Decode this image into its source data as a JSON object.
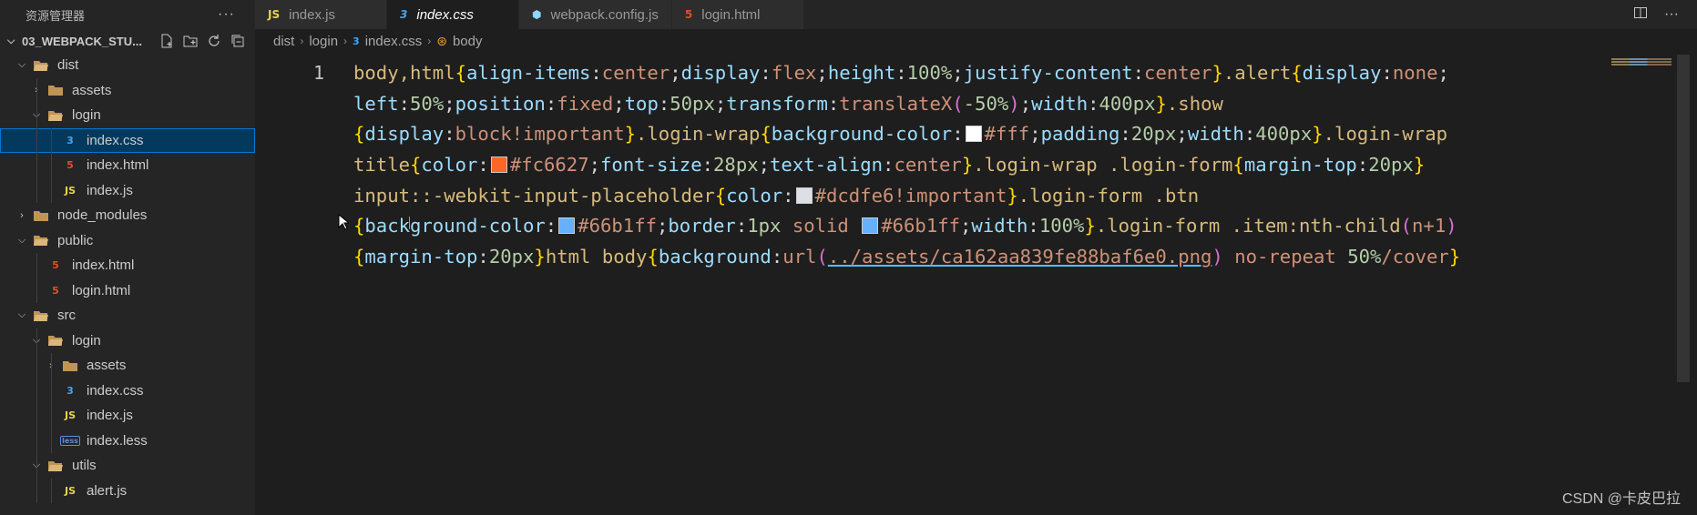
{
  "sidebar": {
    "title": "资源管理器",
    "more": "···",
    "project": "03_WEBPACK_STU...",
    "tree": [
      {
        "label": "dist",
        "icon": "folder-open-icon",
        "depth": 1,
        "chev": "v"
      },
      {
        "label": "assets",
        "icon": "folder-icon",
        "depth": 2,
        "chev": ">"
      },
      {
        "label": "login",
        "icon": "folder-open-icon",
        "depth": 2,
        "chev": "v"
      },
      {
        "label": "index.css",
        "icon": "css-icon",
        "depth": 3,
        "chev": "",
        "selected": true
      },
      {
        "label": "index.html",
        "icon": "html-icon",
        "depth": 3,
        "chev": ""
      },
      {
        "label": "index.js",
        "icon": "js-icon",
        "depth": 3,
        "chev": ""
      },
      {
        "label": "node_modules",
        "icon": "folder-icon",
        "depth": 1,
        "chev": ">"
      },
      {
        "label": "public",
        "icon": "folder-open-icon",
        "depth": 1,
        "chev": "v"
      },
      {
        "label": "index.html",
        "icon": "html-icon",
        "depth": 2,
        "chev": ""
      },
      {
        "label": "login.html",
        "icon": "html-icon",
        "depth": 2,
        "chev": ""
      },
      {
        "label": "src",
        "icon": "folder-open-icon",
        "depth": 1,
        "chev": "v"
      },
      {
        "label": "login",
        "icon": "folder-open-icon",
        "depth": 2,
        "chev": "v"
      },
      {
        "label": "assets",
        "icon": "folder-icon",
        "depth": 3,
        "chev": ">"
      },
      {
        "label": "index.css",
        "icon": "css-icon",
        "depth": 3,
        "chev": ""
      },
      {
        "label": "index.js",
        "icon": "js-icon",
        "depth": 3,
        "chev": ""
      },
      {
        "label": "index.less",
        "icon": "less-icon",
        "depth": 3,
        "chev": ""
      },
      {
        "label": "utils",
        "icon": "folder-open-icon",
        "depth": 2,
        "chev": "v"
      },
      {
        "label": "alert.js",
        "icon": "js-icon",
        "depth": 3,
        "chev": ""
      }
    ]
  },
  "tabs": [
    {
      "label": "index.js",
      "icon_text": "JS",
      "icon_color": "#e8d44d",
      "active": false
    },
    {
      "label": "index.css",
      "icon_text": "3",
      "icon_color": "#42a5f5",
      "active": true
    },
    {
      "label": "webpack.config.js",
      "icon_text": "⬢",
      "icon_color": "#8ed6fb",
      "active": false
    },
    {
      "label": "login.html",
      "icon_text": "5",
      "icon_color": "#e44d26",
      "active": false
    }
  ],
  "breadcrumb": {
    "parts": [
      "dist",
      "login",
      "index.css",
      "body"
    ]
  },
  "editor": {
    "line_number": "1",
    "lines": [
      [
        [
          "sel",
          "body,html"
        ],
        [
          "br",
          "{"
        ],
        [
          "prop",
          "align-items"
        ],
        [
          "pun",
          ":"
        ],
        [
          "val",
          "center"
        ],
        [
          "pun",
          ";"
        ],
        [
          "prop",
          "display"
        ],
        [
          "pun",
          ":"
        ],
        [
          "val",
          "flex"
        ],
        [
          "pun",
          ";"
        ],
        [
          "prop",
          "height"
        ],
        [
          "pun",
          ":"
        ],
        [
          "num",
          "100%"
        ],
        [
          "pun",
          ";"
        ],
        [
          "prop",
          "justify-content"
        ],
        [
          "pun",
          ":"
        ],
        [
          "val",
          "center"
        ],
        [
          "br",
          "}"
        ],
        [
          "sel",
          ".alert"
        ],
        [
          "br",
          "{"
        ],
        [
          "prop",
          "display"
        ],
        [
          "pun",
          ":"
        ],
        [
          "val",
          "none"
        ],
        [
          "pun",
          ";"
        ]
      ],
      [
        [
          "prop",
          "left"
        ],
        [
          "pun",
          ":"
        ],
        [
          "num",
          "50%"
        ],
        [
          "pun",
          ";"
        ],
        [
          "prop",
          "position"
        ],
        [
          "pun",
          ":"
        ],
        [
          "val",
          "fixed"
        ],
        [
          "pun",
          ";"
        ],
        [
          "prop",
          "top"
        ],
        [
          "pun",
          ":"
        ],
        [
          "num",
          "50px"
        ],
        [
          "pun",
          ";"
        ],
        [
          "prop",
          "transform"
        ],
        [
          "pun",
          ":"
        ],
        [
          "val",
          "translateX"
        ],
        [
          "par",
          "("
        ],
        [
          "num",
          "-50%"
        ],
        [
          "par",
          ")"
        ],
        [
          "pun",
          ";"
        ],
        [
          "prop",
          "width"
        ],
        [
          "pun",
          ":"
        ],
        [
          "num",
          "400px"
        ],
        [
          "br",
          "}"
        ],
        [
          "sel",
          ".show"
        ]
      ],
      [
        [
          "br",
          "{"
        ],
        [
          "prop",
          "display"
        ],
        [
          "pun",
          ":"
        ],
        [
          "val",
          "block!important"
        ],
        [
          "br",
          "}"
        ],
        [
          "sel",
          ".login-wrap"
        ],
        [
          "br",
          "{"
        ],
        [
          "prop",
          "background-color"
        ],
        [
          "pun",
          ":"
        ],
        [
          "swatch",
          "#ffffff"
        ],
        [
          "val",
          "#fff"
        ],
        [
          "pun",
          ";"
        ],
        [
          "prop",
          "padding"
        ],
        [
          "pun",
          ":"
        ],
        [
          "num",
          "20px"
        ],
        [
          "pun",
          ";"
        ],
        [
          "prop",
          "width"
        ],
        [
          "pun",
          ":"
        ],
        [
          "num",
          "400px"
        ],
        [
          "br",
          "}"
        ],
        [
          "sel",
          ".login-wrap"
        ]
      ],
      [
        [
          "sel",
          "title"
        ],
        [
          "br",
          "{"
        ],
        [
          "prop",
          "color"
        ],
        [
          "pun",
          ":"
        ],
        [
          "swatch",
          "#fc6627"
        ],
        [
          "val",
          "#fc6627"
        ],
        [
          "pun",
          ";"
        ],
        [
          "prop",
          "font-size"
        ],
        [
          "pun",
          ":"
        ],
        [
          "num",
          "28px"
        ],
        [
          "pun",
          ";"
        ],
        [
          "prop",
          "text-align"
        ],
        [
          "pun",
          ":"
        ],
        [
          "val",
          "center"
        ],
        [
          "br",
          "}"
        ],
        [
          "sel",
          ".login-wrap .login-form"
        ],
        [
          "br",
          "{"
        ],
        [
          "prop",
          "margin-top"
        ],
        [
          "pun",
          ":"
        ],
        [
          "num",
          "20px"
        ],
        [
          "br",
          "}"
        ]
      ],
      [
        [
          "sel",
          "input::-webkit-input-placeholder"
        ],
        [
          "br",
          "{"
        ],
        [
          "prop",
          "color"
        ],
        [
          "pun",
          ":"
        ],
        [
          "swatch",
          "#dcdfe6"
        ],
        [
          "val",
          "#dcdfe6!important"
        ],
        [
          "br",
          "}"
        ],
        [
          "sel",
          ".login-form .btn"
        ]
      ],
      [
        [
          "br",
          "{"
        ],
        [
          "prop",
          "background-color"
        ],
        [
          "pun",
          ":"
        ],
        [
          "swatch",
          "#66b1ff"
        ],
        [
          "val",
          "#66b1ff"
        ],
        [
          "pun",
          ";"
        ],
        [
          "prop",
          "border"
        ],
        [
          "pun",
          ":"
        ],
        [
          "num",
          "1px"
        ],
        [
          "val",
          " solid "
        ],
        [
          "swatch",
          "#66b1ff"
        ],
        [
          "val",
          "#66b1ff"
        ],
        [
          "pun",
          ";"
        ],
        [
          "prop",
          "width"
        ],
        [
          "pun",
          ":"
        ],
        [
          "num",
          "100%"
        ],
        [
          "br",
          "}"
        ],
        [
          "sel",
          ".login-form .item:nth-child"
        ],
        [
          "par",
          "("
        ],
        [
          "val",
          "n+1"
        ],
        [
          "par",
          ")"
        ]
      ],
      [
        [
          "br",
          "{"
        ],
        [
          "prop",
          "margin-top"
        ],
        [
          "pun",
          ":"
        ],
        [
          "num",
          "20px"
        ],
        [
          "br",
          "}"
        ],
        [
          "sel",
          "html body"
        ],
        [
          "br",
          "{"
        ],
        [
          "prop",
          "background"
        ],
        [
          "pun",
          ":"
        ],
        [
          "val",
          "url"
        ],
        [
          "par",
          "("
        ],
        [
          "url",
          "../assets/ca162aa839fe88baf6e0.png"
        ],
        [
          "par",
          ")"
        ],
        [
          "val",
          " no-repeat "
        ],
        [
          "num",
          "50%"
        ],
        [
          "val",
          "/cover"
        ],
        [
          "br",
          "}"
        ]
      ]
    ]
  },
  "watermark": "CSDN @卡皮巴拉"
}
